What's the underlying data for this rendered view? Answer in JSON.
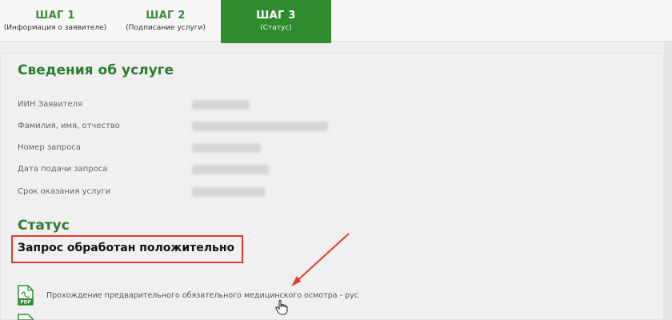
{
  "steps": [
    {
      "num": "ШАГ 1",
      "sub": "(Информация о заявителе)"
    },
    {
      "num": "ШАГ 2",
      "sub": "(Подписание услуги)"
    },
    {
      "num": "ШАГ 3",
      "sub": "(Статус)"
    }
  ],
  "service_info": {
    "title": "Сведения об услуге",
    "rows": [
      {
        "label": "ИИН Заявителя"
      },
      {
        "label": "Фамилия, имя, отчество"
      },
      {
        "label": "Номер запроса"
      },
      {
        "label": "Дата подачи запроса"
      },
      {
        "label": "Срок оказания услуги"
      }
    ]
  },
  "status": {
    "title": "Статус",
    "value": "Запрос обработан положительно"
  },
  "files": [
    {
      "label": "Прохождение предварительного обязательного медицинского осмотра - рус",
      "icon": "pdf-file-icon"
    }
  ],
  "colors": {
    "accent": "#2e8b2e",
    "heading": "#2e7d32",
    "highlight": "#e53935"
  }
}
